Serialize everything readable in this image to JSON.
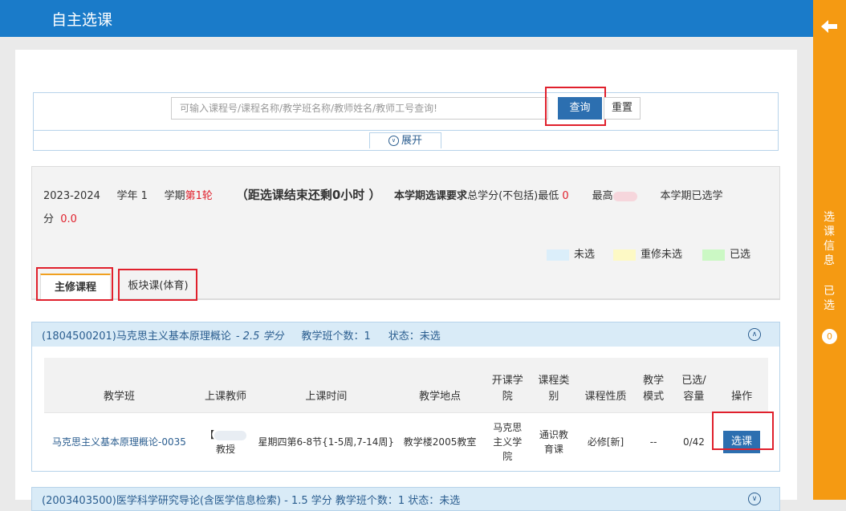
{
  "header": {
    "title": "自主选课"
  },
  "right_rail": {
    "label_info": "选课信息",
    "label_selected": "已选",
    "selected_count": "0"
  },
  "search": {
    "placeholder": "可输入课程号/课程名称/教学班名称/教师姓名/教师工号查询!",
    "query_label": "查询",
    "reset_label": "重置",
    "expand_label": "展开"
  },
  "term": {
    "year": "2023-2024",
    "year_label": "学年 1",
    "term_label": "学期",
    "round": "第1轮",
    "countdown": "（距选课结束还剩0小时 ）",
    "req_label": "本学期选课要求",
    "min_text": "总学分(不包括)最低",
    "min_value": "0",
    "max_text": "最高",
    "chosen_text": "本学期已选学",
    "chosen_text2": "分",
    "chosen_value": "0.0"
  },
  "legend": [
    {
      "label": "未选",
      "color": "#dbeefa"
    },
    {
      "label": "重修未选",
      "color": "#fdf9c5"
    },
    {
      "label": "已选",
      "color": "#cbf8c4"
    }
  ],
  "tabs": [
    {
      "label": "主修课程"
    },
    {
      "label": "板块课(体育)"
    }
  ],
  "course1": {
    "code_name": "(1804500201)马克思主义基本原理概论",
    "credit": "- 2.5 学分",
    "class_count": "教学班个数：1",
    "status": "状态：未选"
  },
  "table": {
    "headers": [
      "教学班",
      "上课教师",
      "上课时间",
      "教学地点",
      "开课学院",
      "课程类别",
      "课程性质",
      "教学模式",
      "已选/容量",
      "操作"
    ],
    "row": {
      "class_name": "马克思主义基本原理概论-0035",
      "teacher_prefix": "【",
      "teacher_title": "教授",
      "time": "星期四第6-8节{1-5周,7-14周}",
      "place": "教学楼2005教室",
      "college": "马克思主义学院",
      "category": "通识教育课",
      "nature": "必修[新]",
      "mode": "--",
      "capacity": "0/42",
      "action": "选课"
    }
  },
  "course2": {
    "text": "(2003403500)医学科学研究导论(含医学信息检索) - 1.5 学分    教学班个数：1    状态：未选"
  }
}
